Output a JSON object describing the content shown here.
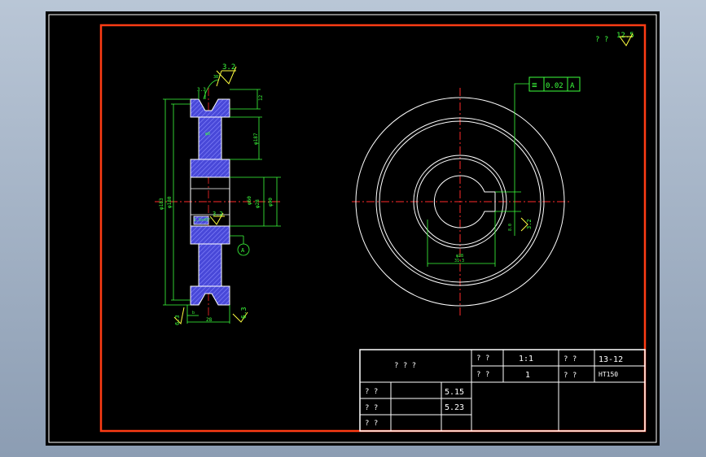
{
  "colors": {
    "background": "#000000",
    "frame": "#ff3c14",
    "line": "#ffffff",
    "dimension": "#3cff3c",
    "centerline": "#ff2a2a",
    "hatch": "#4848d8",
    "symbol": "#ffff40"
  },
  "roughness": {
    "corner_label": "? ?",
    "corner_value": "12.5",
    "top_value": "3.2",
    "mid_value": "3.2",
    "bottom_value": "6.3"
  },
  "tolerance": {
    "symbol": "≡",
    "value": "0.02",
    "datum": "A"
  },
  "datum_label": "A",
  "section_dims": {
    "top_width": "3.3",
    "left_dia_outer": "φ183",
    "left_dia_inner": "φ180",
    "right_small": "12",
    "right_dia_mid": "φ187",
    "right_dia_hub": "φ60",
    "right_dia_bore": "φ28",
    "right_dia_hub2": "φ90",
    "groove_note": "φ8",
    "chamfer": "1.5x45°",
    "bottom_width": "28",
    "bottom_small": "b"
  },
  "front_dims": {
    "keyway_width": "8.0",
    "keyway_depth": "31.3",
    "bore": "φ28"
  },
  "title_block": {
    "part_name": "? ? ?",
    "scale_label": "? ?",
    "scale_value": "1:1",
    "qty_label": "? ?",
    "qty_value": "1",
    "drawing_label": "? ?",
    "drawing_no": "13-12",
    "material_label": "? ?",
    "material": "HT150",
    "designer_label": "? ?",
    "designer_date": "5.15",
    "checker_label": "? ?",
    "checker_date": "5.23",
    "approver_label": "? ?"
  }
}
